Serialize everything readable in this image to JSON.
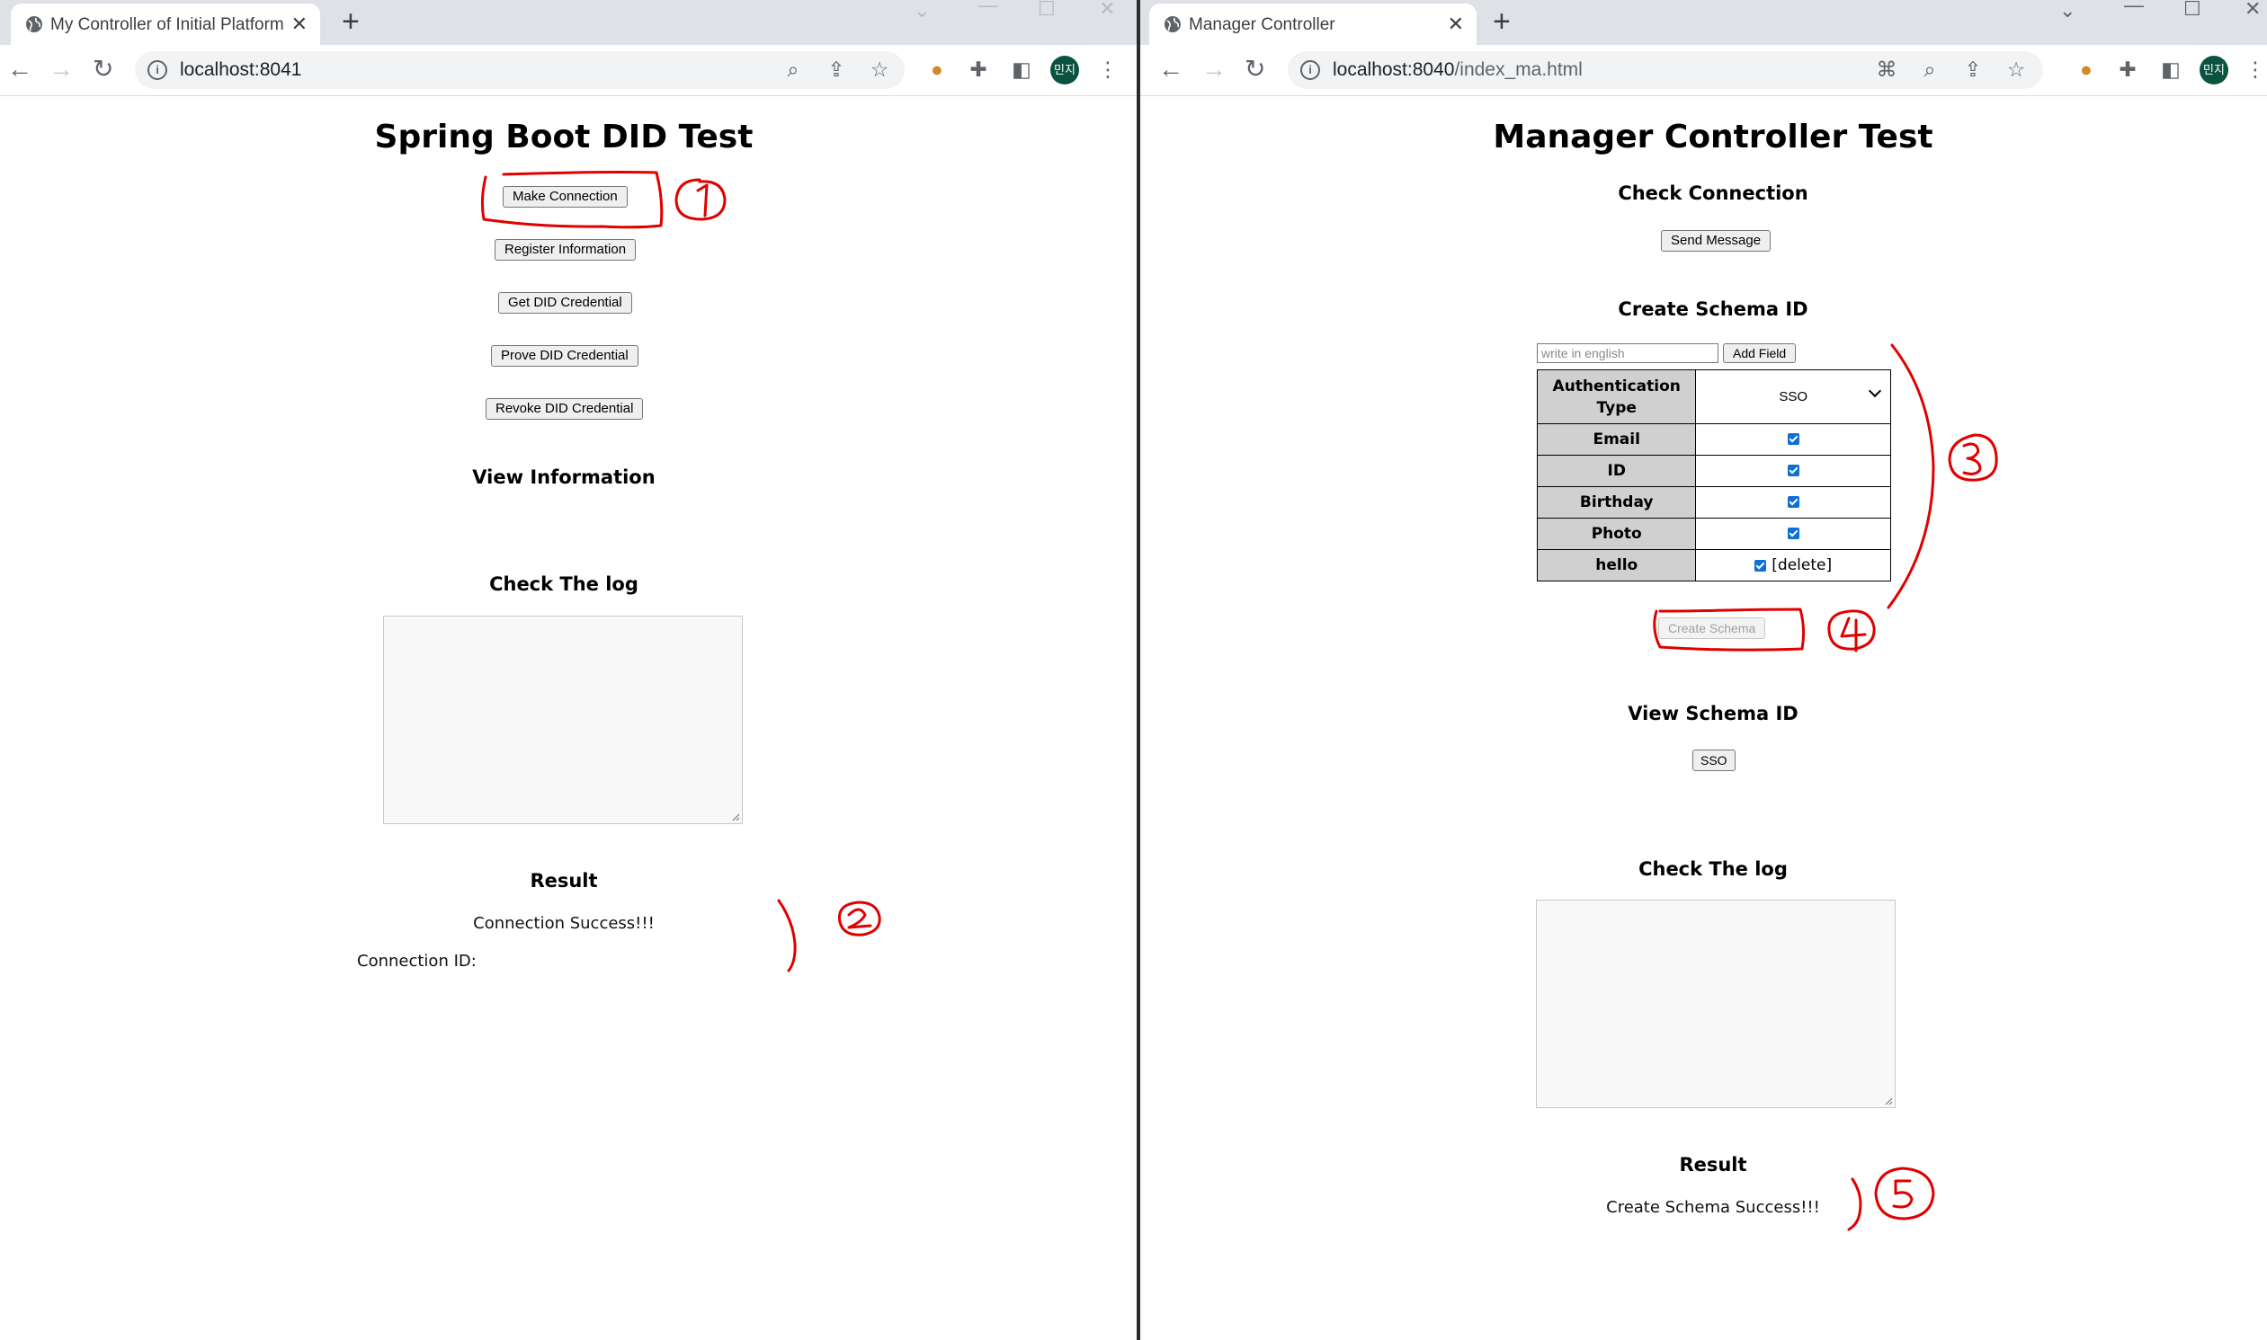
{
  "left_window": {
    "tab_title": "My Controller of Initial Platform",
    "url": "localhost:8041",
    "avatar": "민지",
    "page": {
      "title": "Spring Boot DID Test",
      "buttons": {
        "make_connection": "Make Connection",
        "register_information": "Register Information",
        "get_credential": "Get DID Credential",
        "prove_credential": "Prove DID Credential",
        "revoke_credential": "Revoke DID Credential"
      },
      "view_information": "View Information",
      "log_heading": "Check The log",
      "result_heading": "Result",
      "result_message": "Connection Success!!!",
      "connection_id_label": "Connection ID:"
    }
  },
  "right_window": {
    "tab_title": "Manager Controller",
    "url_host": "localhost:8040",
    "url_path": "/index_ma.html",
    "avatar": "민지",
    "page": {
      "title": "Manager Controller Test",
      "check_connection": "Check Connection",
      "send_message": "Send Message",
      "create_schema_heading": "Create Schema ID",
      "field_placeholder": "write in english",
      "add_field": "Add Field",
      "auth_type_label": "Authentication Type",
      "auth_type_selected": "SSO",
      "fields": [
        {
          "label": "Email",
          "checked": true
        },
        {
          "label": "ID",
          "checked": true
        },
        {
          "label": "Birthday",
          "checked": true
        },
        {
          "label": "Photo",
          "checked": true
        },
        {
          "label": "hello",
          "checked": true,
          "delete_label": "[delete]"
        }
      ],
      "create_schema": "Create Schema",
      "view_schema_heading": "View Schema ID",
      "schema_button": "SSO",
      "log_heading": "Check The log",
      "result_heading": "Result",
      "result_message": "Create Schema Success!!!"
    }
  },
  "annotation_color": "#e00000"
}
